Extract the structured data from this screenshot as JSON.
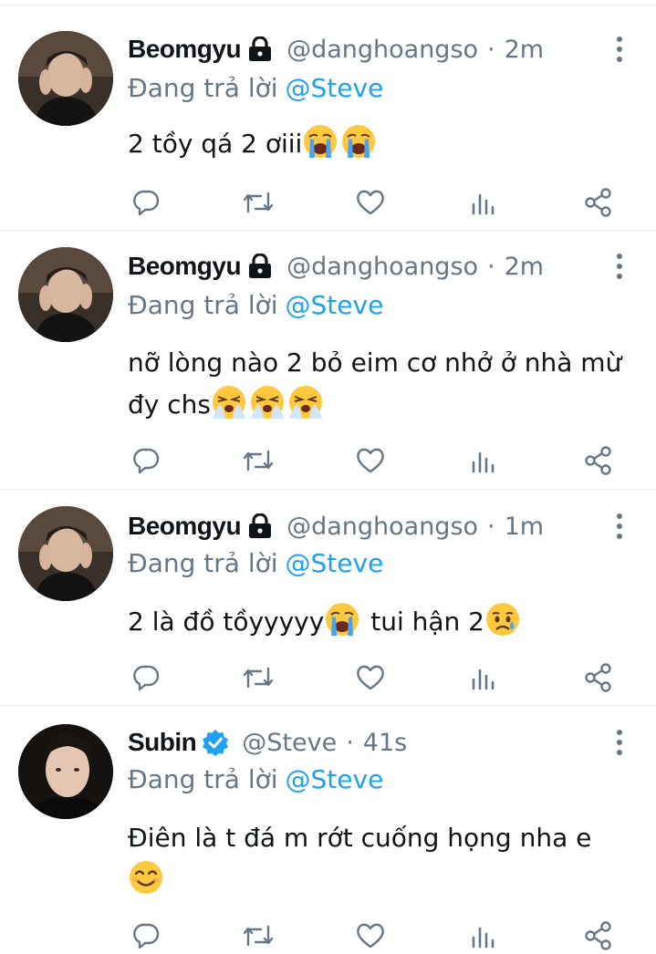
{
  "tweets": [
    {
      "name": "Beomgyu",
      "badge": "lock-icon",
      "handle": "@danghoangso",
      "separator": "·",
      "time": "2m",
      "reply_prefix": "Đang trả lời",
      "reply_mention": "@Steve",
      "body_text": "2 tồy qá 2 ơiii",
      "body_emoji": [
        "crying-face-emoji",
        "crying-face-emoji"
      ]
    },
    {
      "name": "Beomgyu",
      "badge": "lock-icon",
      "handle": "@danghoangso",
      "separator": "·",
      "time": "2m",
      "reply_prefix": "Đang trả lời",
      "reply_mention": "@Steve",
      "body_text": "nỡ lòng nào 2 bỏ eim cơ nhở ở nhà mừ đy chs",
      "body_emoji": [
        "tears-face-emoji",
        "tears-face-emoji",
        "tears-face-emoji"
      ]
    },
    {
      "name": "Beomgyu",
      "badge": "lock-icon",
      "handle": "@danghoangso",
      "separator": "·",
      "time": "1m",
      "reply_prefix": "Đang trả lời",
      "reply_mention": "@Steve",
      "body_text": "2 là đồ tồyyyyy",
      "body_text_after": " tui hận 2",
      "body_emoji": [
        "crying-face-emoji"
      ],
      "body_emoji_after": [
        "sad-tear-face-emoji"
      ]
    },
    {
      "name": "Subin",
      "badge": "verified-icon",
      "handle": "@Steve",
      "separator": "·",
      "time": "41s",
      "reply_prefix": "Đang trả lời",
      "reply_mention": "@Steve",
      "body_text": "Điên là t đá m rớt cuống họng nha e",
      "body_emoji": [
        "smiling-face-emoji"
      ]
    }
  ],
  "action_icons": [
    "reply-icon",
    "retweet-icon",
    "like-icon",
    "analytics-icon",
    "share-icon"
  ],
  "colors": {
    "accent": "#1da1f2",
    "secondary_text": "#657786",
    "divider": "#e6ecf0",
    "primary_text": "#0f1419"
  }
}
